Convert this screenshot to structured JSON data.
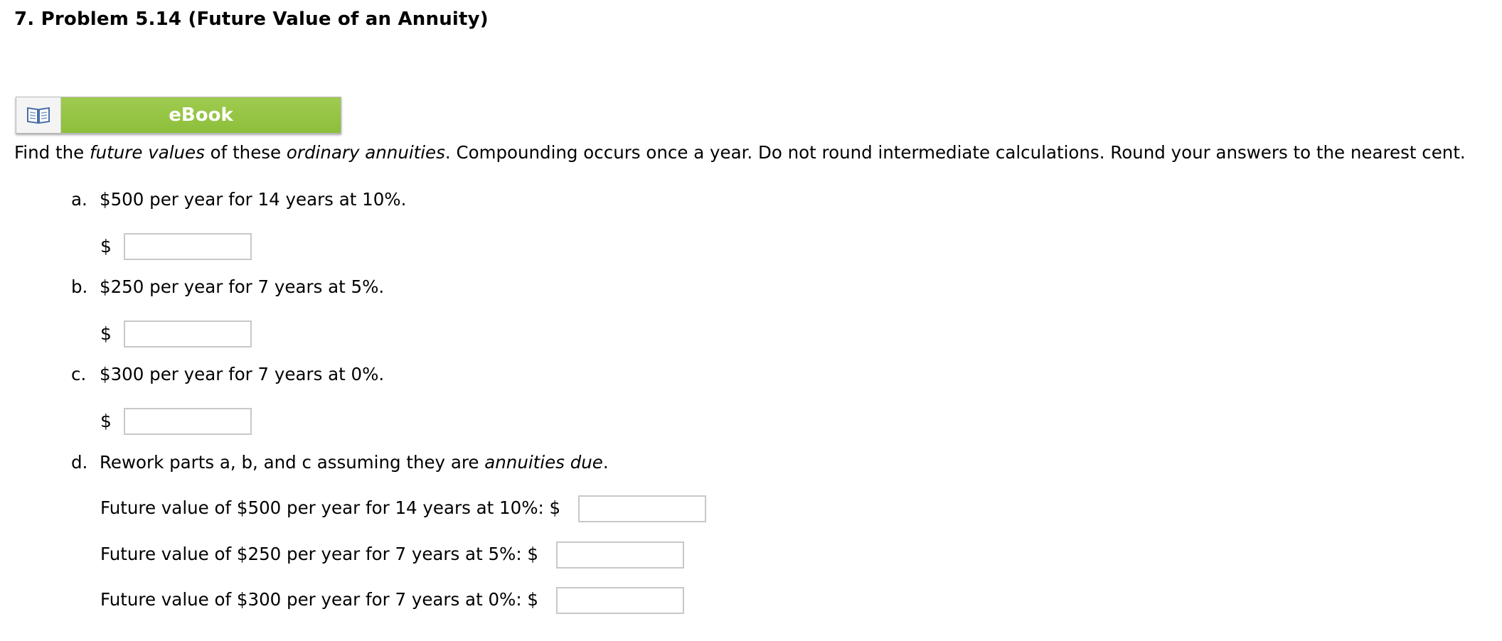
{
  "problem": {
    "title": "7.  Problem 5.14 (Future Value of an Annuity)"
  },
  "ebook_button": {
    "label": "eBook",
    "icon": "open-book-icon"
  },
  "instructions": {
    "part1": "Find the ",
    "em1": "future values",
    "part2": " of these ",
    "em2": "ordinary annuities",
    "part3": ". Compounding occurs once a year. Do not round intermediate calculations. Round your answers to the nearest cent."
  },
  "items": [
    {
      "letter": "a.",
      "text": "$500 per year for 14 years at 10%.",
      "currency": "$",
      "value": ""
    },
    {
      "letter": "b.",
      "text": "$250 per year for 7 years at 5%.",
      "currency": "$",
      "value": ""
    },
    {
      "letter": "c.",
      "text": "$300 per year for 7 years at 0%.",
      "currency": "$",
      "value": ""
    }
  ],
  "part_d": {
    "letter": "d.",
    "text1": "Rework parts a, b, and c assuming they are ",
    "em": "annuities due",
    "text2": ".",
    "lines": [
      {
        "label": "Future value of $500 per year for 14 years at 10%: $",
        "value": ""
      },
      {
        "label": "Future value of $250 per year for 7 years at 5%: $",
        "value": ""
      },
      {
        "label": "Future value of $300 per year for 7 years at 0%: $",
        "value": ""
      }
    ]
  }
}
